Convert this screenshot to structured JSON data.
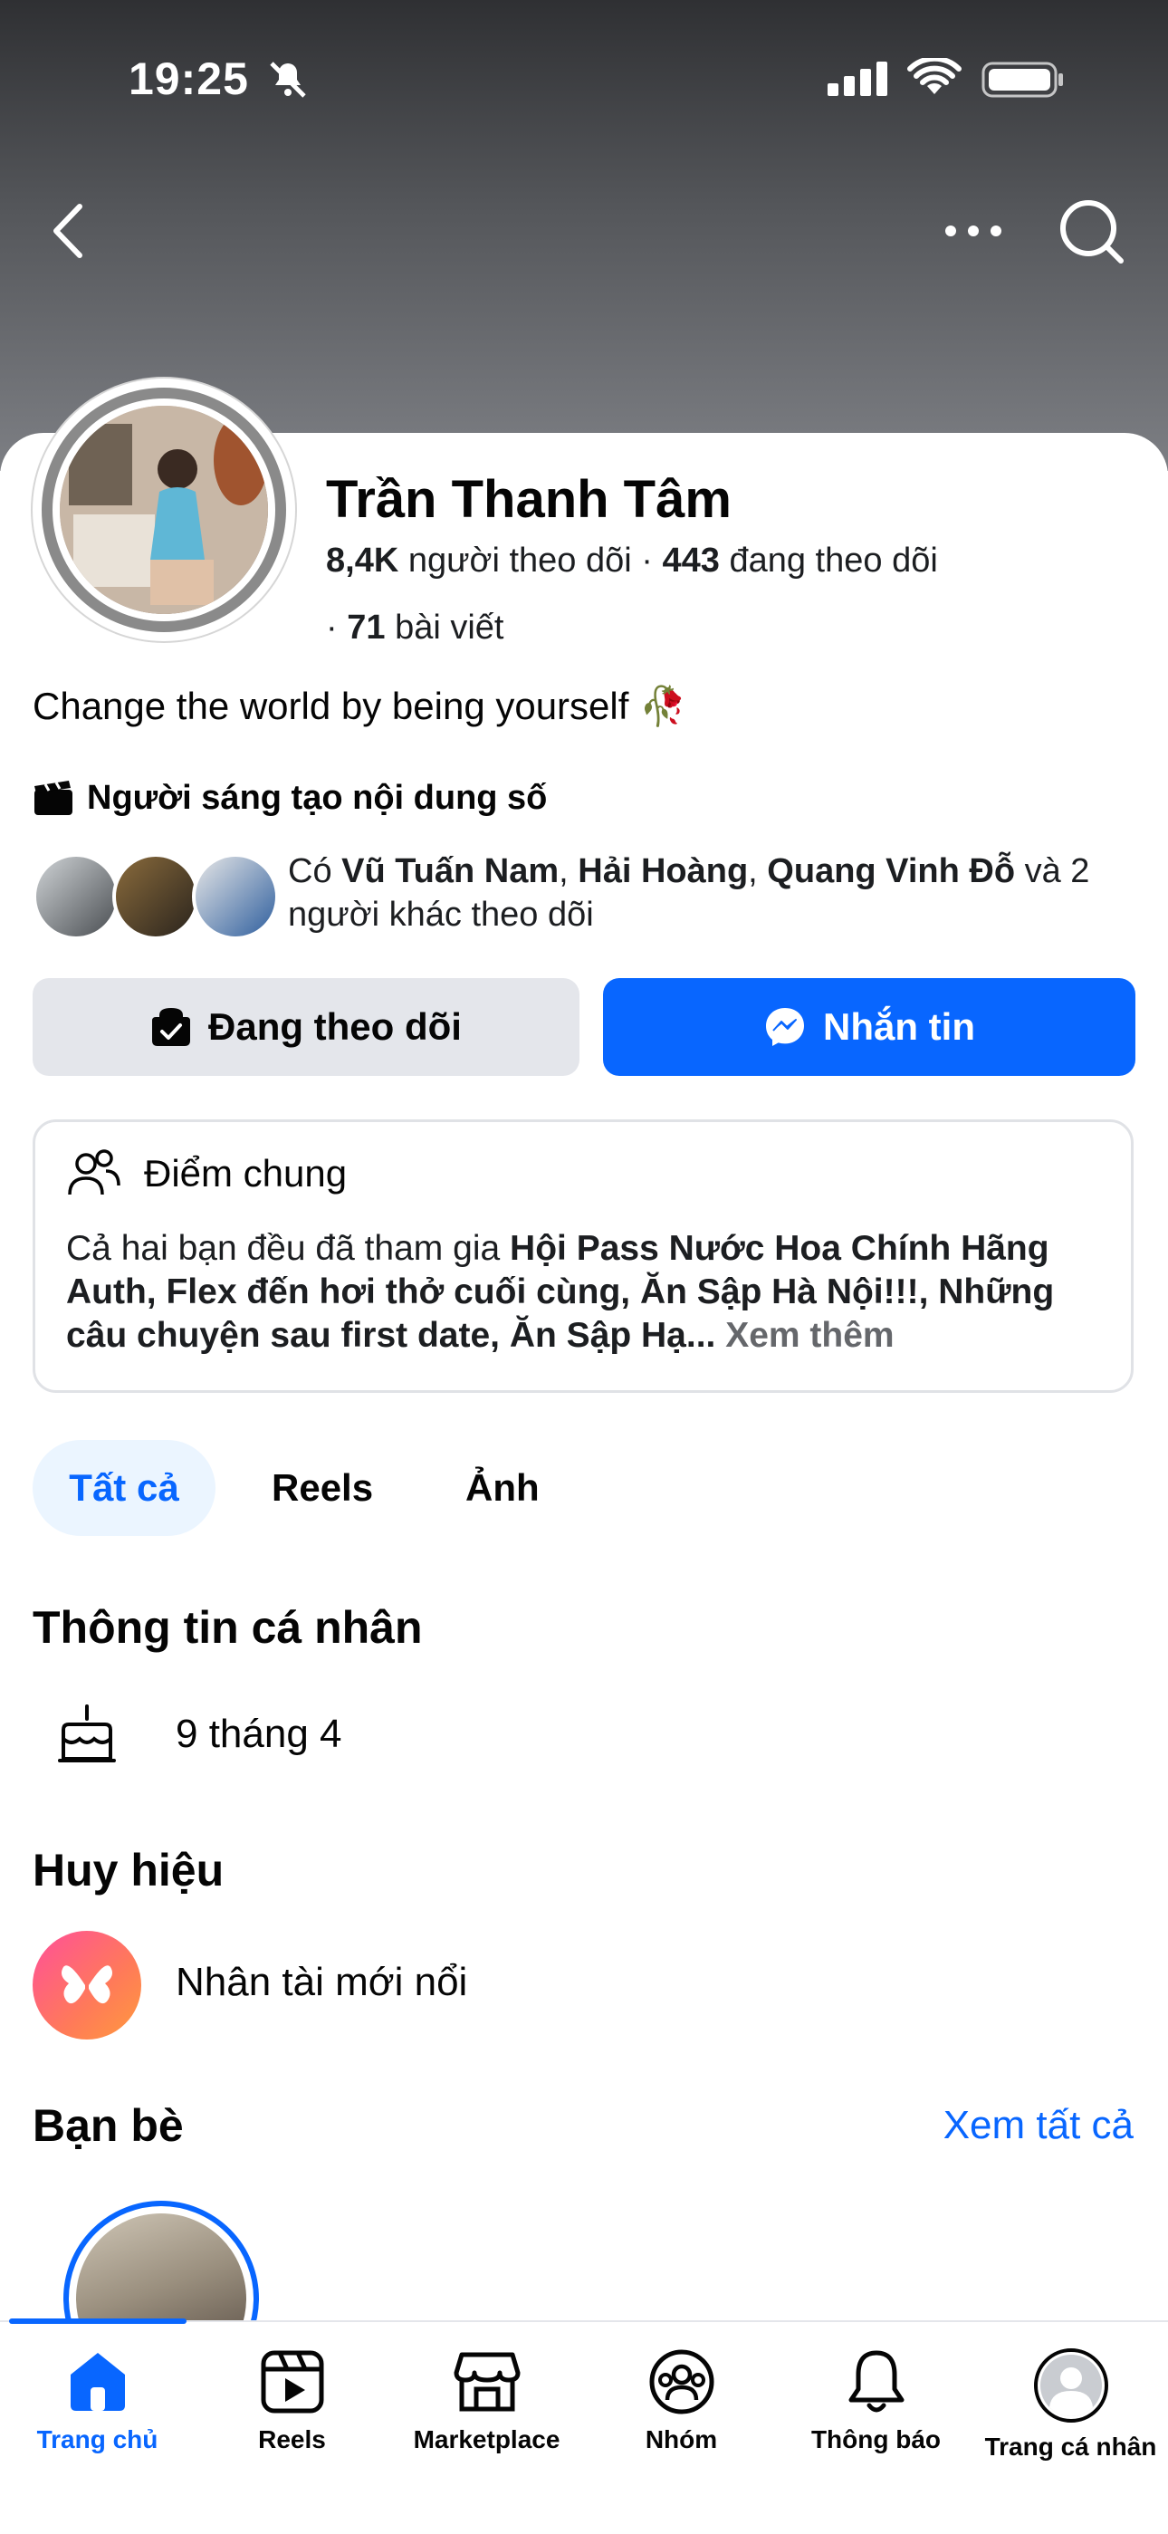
{
  "status_bar": {
    "time": "19:25"
  },
  "profile": {
    "name": "Trần Thanh Tâm",
    "followers_count": "8,4K",
    "followers_label": "người theo dõi",
    "following_count": "443",
    "following_label": "đang theo dõi",
    "posts_count": "71",
    "posts_label": "bài viết",
    "bio": "Change the world by being yourself",
    "bio_emoji": "🥀",
    "creator_label": "Người sáng tạo nội dung số"
  },
  "mutual": {
    "prefix": "Có",
    "name1": "Vũ Tuấn Nam",
    "name2": "Hải Hoàng",
    "name3": "Quang Vinh Đỗ",
    "suffix": "và 2 người khác theo dõi"
  },
  "actions": {
    "following_label": "Đang theo dõi",
    "message_label": "Nhắn tin"
  },
  "in_common": {
    "title": "Điểm chung",
    "text_prefix": "Cả hai bạn đều đã tham gia",
    "groups": "Hội Pass Nước Hoa Chính Hãng Auth, Flex đến hơi thở cuối cùng, Ăn Sập Hà Nội!!!, Những câu chuyện sau first date, Ăn Sập Hạ...",
    "see_more": "Xem thêm"
  },
  "tabs": [
    {
      "label": "Tất cả",
      "active": true
    },
    {
      "label": "Reels"
    },
    {
      "label": "Ảnh"
    }
  ],
  "personal_info": {
    "title": "Thông tin cá nhân",
    "birthday": "9 tháng 4"
  },
  "badges": {
    "title": "Huy hiệu",
    "badge_label": "Nhân tài mới nổi"
  },
  "friends": {
    "title": "Bạn bè",
    "see_all": "Xem tất cả"
  },
  "bottom_nav": [
    {
      "label": "Trang chủ",
      "icon": "home-icon",
      "active": true
    },
    {
      "label": "Reels",
      "icon": "reels-icon"
    },
    {
      "label": "Marketplace",
      "icon": "marketplace-icon"
    },
    {
      "label": "Nhóm",
      "icon": "groups-icon"
    },
    {
      "label": "Thông báo",
      "icon": "bell-icon"
    },
    {
      "label": "Trang cá nhân",
      "icon": "profile-icon"
    }
  ],
  "colors": {
    "accent": "#0866ff",
    "button_gray": "#e4e6eb",
    "tab_active_bg": "#ebf5ff"
  }
}
